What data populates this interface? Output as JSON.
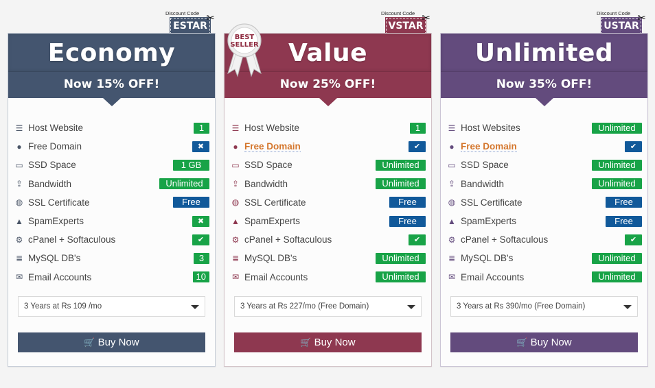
{
  "plans": [
    {
      "name": "Economy",
      "discount_text": "Now 15% OFF!",
      "coupon_caption": "Discount Code",
      "coupon_code": "ESTAR",
      "accent": "#44556f",
      "features": [
        {
          "icon": "server-icon",
          "label": "Host Website",
          "value": "1",
          "badge": "green"
        },
        {
          "icon": "globe-icon",
          "label": "Free Domain",
          "value": "✖",
          "badge": "blue"
        },
        {
          "icon": "hdd-icon",
          "label": "SSD Space",
          "value": "1 GB",
          "badge": "green"
        },
        {
          "icon": "upload-icon",
          "label": "Bandwidth",
          "value": "Unlimited",
          "badge": "green"
        },
        {
          "icon": "lock-icon",
          "label": "SSL Certificate",
          "value": "Free",
          "badge": "blue"
        },
        {
          "icon": "spam-filter-icon",
          "label": "SpamExperts",
          "value": "✖",
          "badge": "green"
        },
        {
          "icon": "gears-icon",
          "label": "cPanel + Softaculous",
          "value": "✔",
          "badge": "green"
        },
        {
          "icon": "database-icon",
          "label": "MySQL DB's",
          "value": "3",
          "badge": "green"
        },
        {
          "icon": "envelope-icon",
          "label": "Email Accounts",
          "value": "10",
          "badge": "green"
        }
      ],
      "term_select": "3 Years at Rs 109 /mo",
      "buy_label": "Buy Now"
    },
    {
      "name": "Value",
      "discount_text": "Now 25% OFF!",
      "coupon_caption": "Discount Code",
      "coupon_code": "VSTAR",
      "ribbon_text": [
        "BEST",
        "SELLER"
      ],
      "accent": "#8e3850",
      "features": [
        {
          "icon": "server-icon",
          "label": "Host Website",
          "value": "1",
          "badge": "green"
        },
        {
          "icon": "globe-icon",
          "label": "Free Domain",
          "value": "✔",
          "badge": "blue",
          "highlight": true
        },
        {
          "icon": "hdd-icon",
          "label": "SSD Space",
          "value": "Unlimited",
          "badge": "green"
        },
        {
          "icon": "upload-icon",
          "label": "Bandwidth",
          "value": "Unlimited",
          "badge": "green"
        },
        {
          "icon": "lock-icon",
          "label": "SSL Certificate",
          "value": "Free",
          "badge": "blue"
        },
        {
          "icon": "spam-filter-icon",
          "label": "SpamExperts",
          "value": "Free",
          "badge": "blue"
        },
        {
          "icon": "gears-icon",
          "label": "cPanel + Softaculous",
          "value": "✔",
          "badge": "green"
        },
        {
          "icon": "database-icon",
          "label": "MySQL DB's",
          "value": "Unlimited",
          "badge": "green"
        },
        {
          "icon": "envelope-icon",
          "label": "Email Accounts",
          "value": "Unlimited",
          "badge": "green"
        }
      ],
      "term_select": "3 Years at Rs 227/mo (Free Domain)",
      "buy_label": "Buy Now"
    },
    {
      "name": "Unlimited",
      "discount_text": "Now 35% OFF!",
      "coupon_caption": "Discount Code",
      "coupon_code": "USTAR",
      "accent": "#634b7d",
      "features": [
        {
          "icon": "server-icon",
          "label": "Host Websites",
          "value": "Unlimited",
          "badge": "green"
        },
        {
          "icon": "globe-icon",
          "label": "Free Domain",
          "value": "✔",
          "badge": "blue",
          "highlight": true
        },
        {
          "icon": "hdd-icon",
          "label": "SSD Space",
          "value": "Unlimited",
          "badge": "green"
        },
        {
          "icon": "upload-icon",
          "label": "Bandwidth",
          "value": "Unlimited",
          "badge": "green"
        },
        {
          "icon": "lock-icon",
          "label": "SSL Certificate",
          "value": "Free",
          "badge": "blue"
        },
        {
          "icon": "spam-filter-icon",
          "label": "SpamExperts",
          "value": "Free",
          "badge": "blue"
        },
        {
          "icon": "gears-icon",
          "label": "cPanel + Softaculous",
          "value": "✔",
          "badge": "green"
        },
        {
          "icon": "database-icon",
          "label": "MySQL DB's",
          "value": "Unlimited",
          "badge": "green"
        },
        {
          "icon": "envelope-icon",
          "label": "Email Accounts",
          "value": "Unlimited",
          "badge": "green"
        }
      ],
      "term_select": "3 Years at Rs 390/mo (Free Domain)",
      "buy_label": "Buy Now"
    }
  ],
  "icons": {
    "server-icon": "☰",
    "globe-icon": "●",
    "hdd-icon": "▭",
    "upload-icon": "⇪",
    "lock-icon": "◍",
    "spam-filter-icon": "▲",
    "gears-icon": "⚙",
    "database-icon": "≣",
    "envelope-icon": "✉",
    "cart-icon": "🛒",
    "scissors-icon": "✂"
  },
  "badge_colors": {
    "green": "#18a347",
    "blue": "#11599a"
  },
  "highlight_color": "#d4762c"
}
